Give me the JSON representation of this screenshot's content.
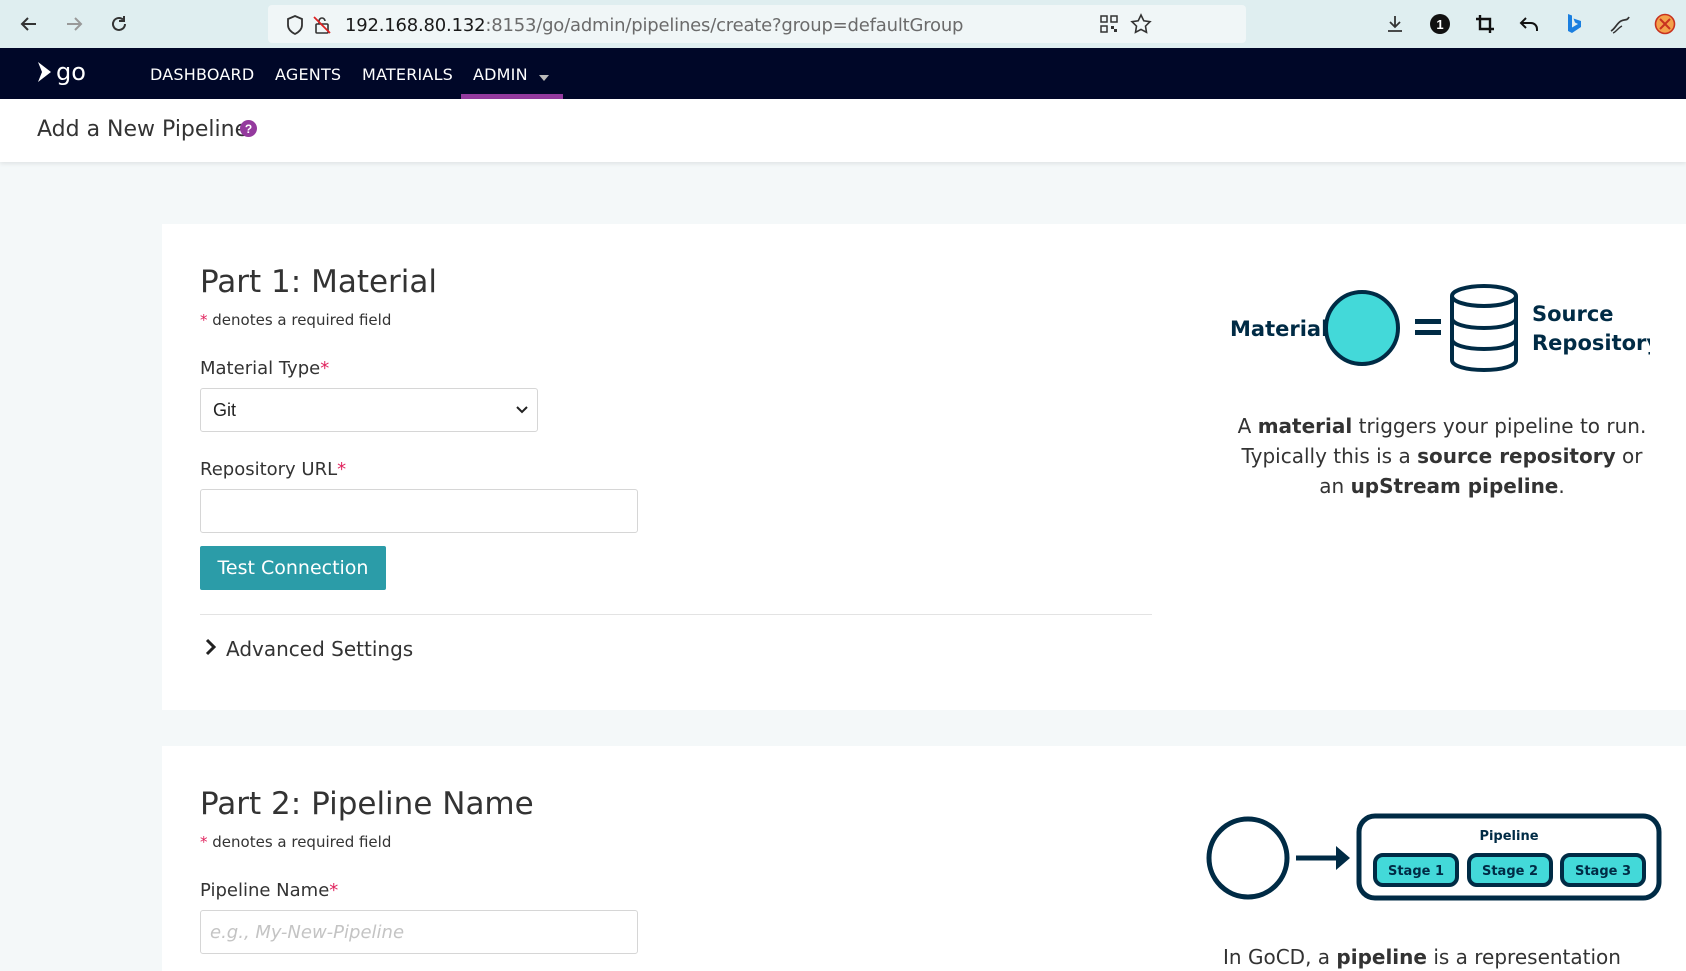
{
  "browser": {
    "url_host": "192.168.80.132",
    "url_rest": ":8153/go/admin/pipelines/create?group=defaultGroup"
  },
  "header": {
    "logo_text": "go",
    "nav": [
      "DASHBOARD",
      "AGENTS",
      "MATERIALS",
      "ADMIN"
    ]
  },
  "page": {
    "title": "Add a New Pipeline"
  },
  "part1": {
    "title": "Part 1: Material",
    "required_note": "denotes a required field",
    "material_type_label": "Material Type",
    "material_type_value": "Git",
    "repo_url_label": "Repository URL",
    "repo_url_value": "",
    "test_button": "Test Connection",
    "advanced_settings": "Advanced Settings",
    "illustration": {
      "left_label": "Material",
      "right_label_1": "Source",
      "right_label_2": "Repository"
    },
    "description": {
      "l1_a": "A ",
      "l1_b": "material",
      "l1_c": " triggers your pipeline to run.",
      "l2_a": "Typically this is a ",
      "l2_b": "source repository",
      "l2_c": " or",
      "l3_a": "an ",
      "l3_b": "upStream pipeline",
      "l3_c": "."
    }
  },
  "part2": {
    "title": "Part 2: Pipeline Name",
    "required_note": "denotes a required field",
    "pipeline_name_label": "Pipeline Name",
    "pipeline_name_placeholder": "e.g., My-New-Pipeline",
    "illustration": {
      "pipeline_label": "Pipeline",
      "stages": [
        "Stage 1",
        "Stage 2",
        "Stage 3"
      ]
    },
    "description": {
      "a": "In GoCD, a ",
      "b": "pipeline",
      "c": " is a representation"
    }
  },
  "colors": {
    "header_bg": "#000728",
    "accent_purple": "#943a9e",
    "button_teal": "#2b9ca8",
    "illus_cyan": "#43d9d9",
    "illus_navy": "#002b45"
  }
}
